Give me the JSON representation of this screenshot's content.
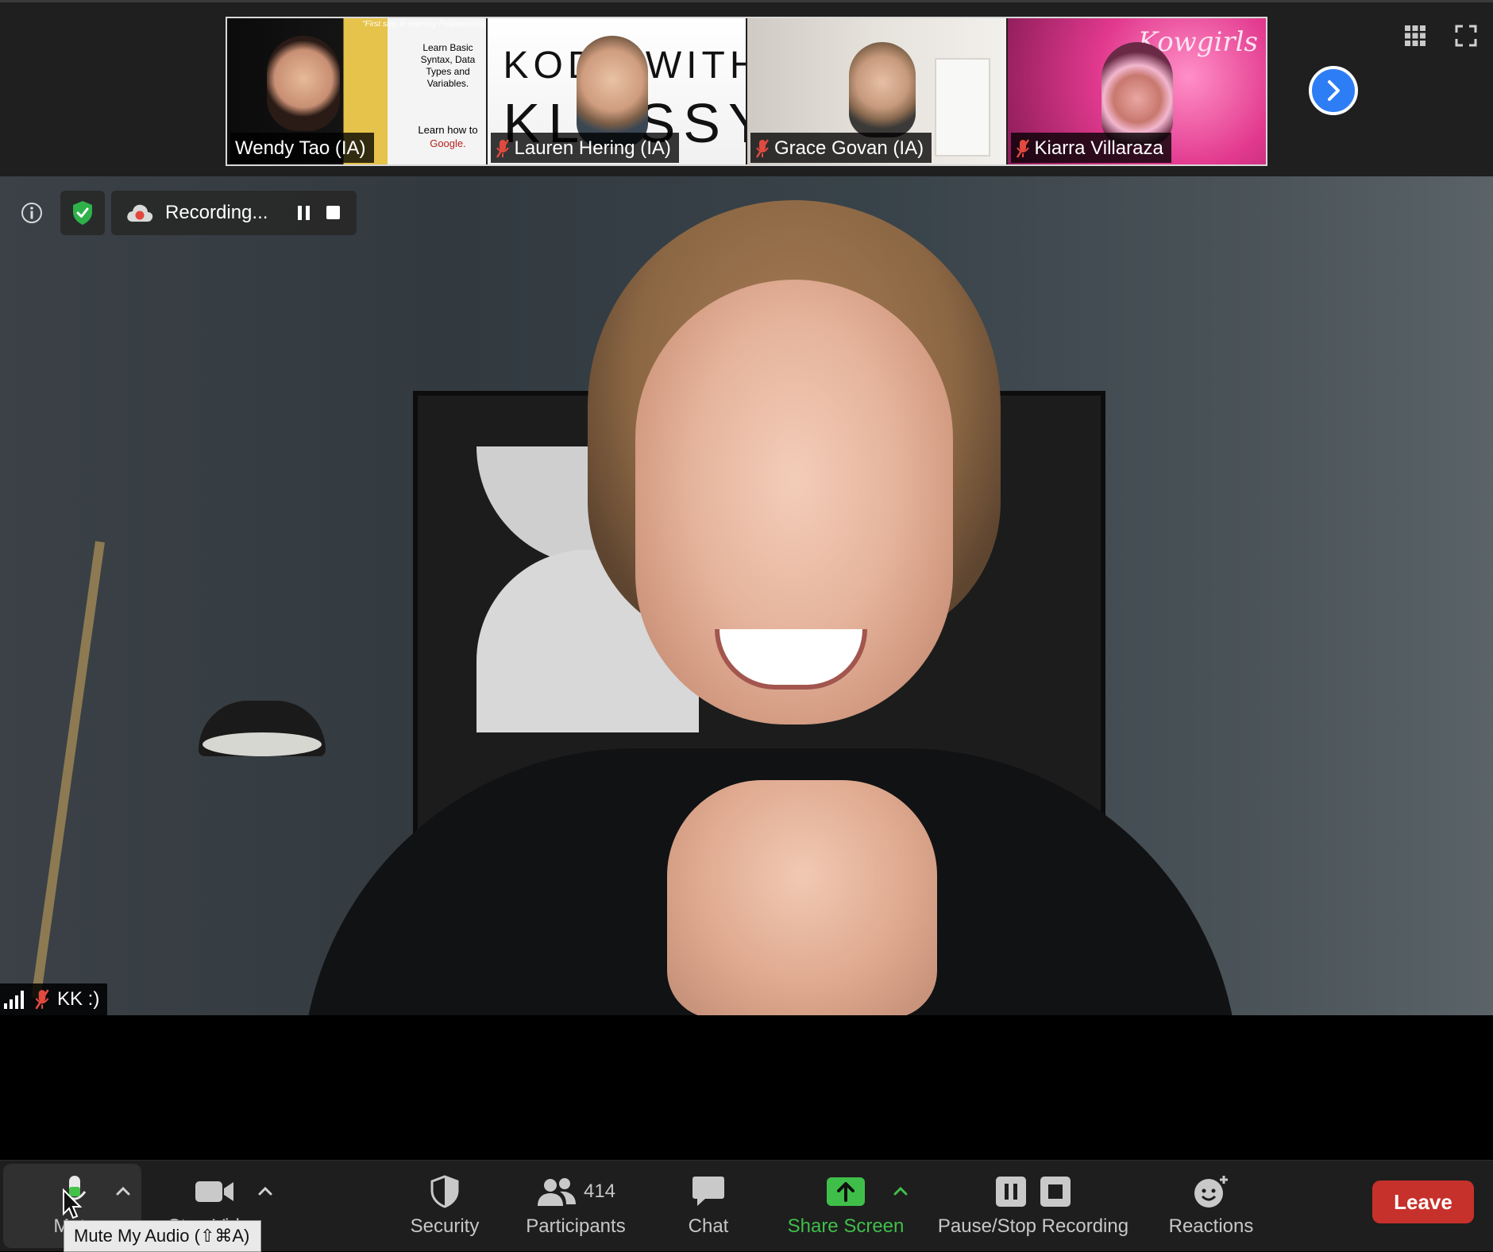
{
  "thumbnails": [
    {
      "name": "Wendy Tao (IA)",
      "muted": false,
      "slide_top": "\"First step in learning Programming\"",
      "slide_line1": "Learn Basic Syntax, Data Types and Variables.",
      "slide_line2_a": "Learn how to ",
      "slide_line2_b": "Google."
    },
    {
      "name": "Lauren Hering (IA)",
      "muted": true,
      "bg_line1": "KODE WITH",
      "bg_line2": "KLOSSY"
    },
    {
      "name": "Grace Govan (IA)",
      "muted": true
    },
    {
      "name": "Kiarra Villaraza",
      "muted": true,
      "bg_script": "Kowgirls"
    }
  ],
  "top_controls": {
    "next_icon": "chevron-right-icon",
    "gallery_icon": "grid-icon",
    "fullscreen_icon": "fullscreen-icon"
  },
  "meeting": {
    "recording_label": "Recording...",
    "speaker_name": "KK :)"
  },
  "toolbar": {
    "mute_label": "Mute",
    "stop_video_label": "Stop Video",
    "security_label": "Security",
    "participants_label": "Participants",
    "participants_count": "414",
    "chat_label": "Chat",
    "share_label": "Share Screen",
    "pause_stop_label": "Pause/Stop Recording",
    "reactions_label": "Reactions",
    "leave_label": "Leave",
    "tooltip": "Mute My Audio (⇧⌘A)"
  },
  "colors": {
    "accent_blue": "#2d7df5",
    "share_green": "#3fbf4a",
    "leave_red": "#c7312b",
    "shield_green": "#2fb14a",
    "recording_red": "#e3463d"
  }
}
